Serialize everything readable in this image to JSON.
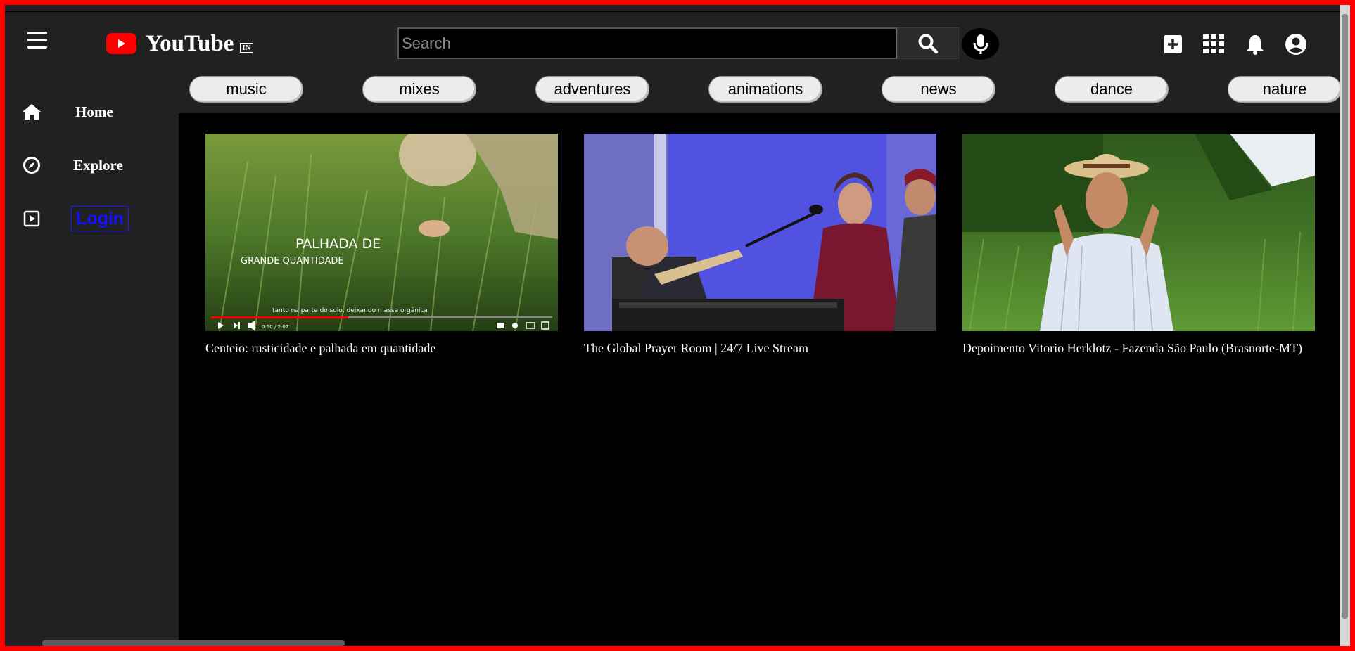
{
  "header": {
    "logo_text": "YouTube",
    "logo_region": "IN",
    "search_placeholder": "Search",
    "icons": [
      "menu-icon",
      "search-icon",
      "mic-icon",
      "create-icon",
      "apps-icon",
      "bell-icon",
      "account-icon"
    ]
  },
  "sidebar": {
    "items": [
      {
        "label": "Home",
        "icon": "home-icon"
      },
      {
        "label": "Explore",
        "icon": "compass-icon"
      },
      {
        "label": "Login",
        "icon": "login-icon"
      }
    ]
  },
  "chips": [
    "music",
    "mixes",
    "adventures",
    "animations",
    "news",
    "dance",
    "nature"
  ],
  "videos": [
    {
      "title": "Centeio: rusticidade e palhada em quantidade",
      "overlay_line1": "PALHADA DE",
      "overlay_line2": "GRANDE QUANTIDADE",
      "subtitle": "tanto na parte do solo, deixando massa orgânica",
      "time": "0:50 / 2:07"
    },
    {
      "title": "The Global Prayer Room | 24/7 Live Stream"
    },
    {
      "title": "Depoimento Vitorio Herklotz - Fazenda São Paulo (Brasnorte-MT)"
    }
  ],
  "colors": {
    "brand": "#ff0000",
    "header_bg": "#212121",
    "page_bg": "#000000",
    "login_link": "#1212ff",
    "chip_bg": "#ececec"
  }
}
